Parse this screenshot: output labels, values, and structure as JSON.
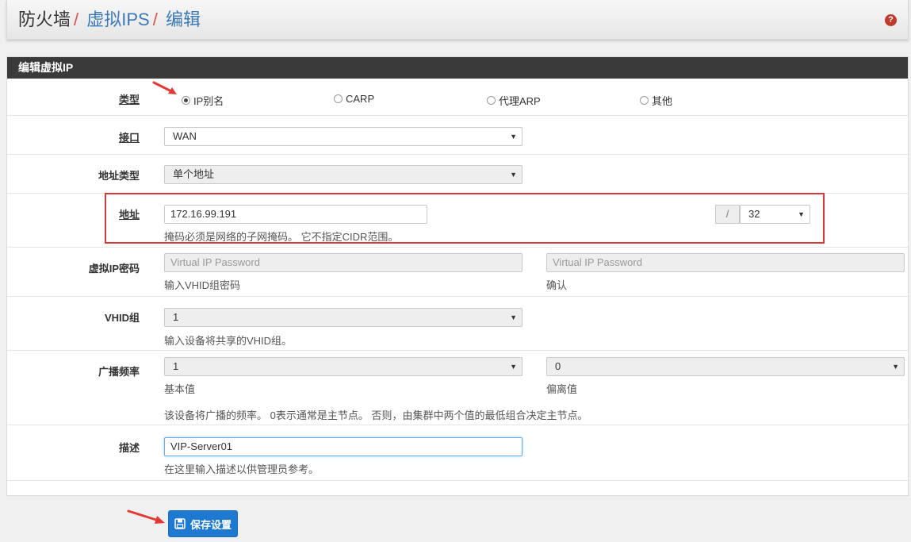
{
  "breadcrumb": {
    "part1": "防火墙",
    "part2": "虚拟IPS",
    "part3": "编辑",
    "sep": "/"
  },
  "help_icon": "?",
  "panel": {
    "title": "编辑虚拟IP"
  },
  "type": {
    "label": "类型",
    "options": [
      "IP别名",
      "CARP",
      "代理ARP",
      "其他"
    ],
    "selected": "IP别名"
  },
  "interface": {
    "label": "接口",
    "value": "WAN"
  },
  "address_type": {
    "label": "地址类型",
    "value": "单个地址"
  },
  "address": {
    "label": "地址",
    "value": "172.16.99.191",
    "slash": "/",
    "mask": "32",
    "help": "掩码必须是网络的子网掩码。 它不指定CIDR范围。"
  },
  "vip_password": {
    "label": "虚拟IP密码",
    "placeholder1": "Virtual IP Password",
    "help1": "输入VHID组密码",
    "placeholder2": "Virtual IP Password",
    "help2": "确认"
  },
  "vhid": {
    "label": "VHID组",
    "value": "1",
    "help": "输入设备将共享的VHID组。"
  },
  "adv_freq": {
    "label": "广播频率",
    "base_value": "1",
    "base_help": "基本值",
    "skew_value": "0",
    "skew_help": "偏离值",
    "help": "该设备将广播的频率。 0表示通常是主节点。 否则，由集群中两个值的最低组合决定主节点。"
  },
  "description": {
    "label": "描述",
    "value": "VIP-Server01",
    "help": "在这里输入描述以供管理员参考。"
  },
  "save_button": {
    "label": "保存设置"
  },
  "colors": {
    "accent": "#1e7ad1",
    "highlight": "#d9383a",
    "panel_head": "#3a3a3a",
    "link": "#3c7ab7"
  }
}
